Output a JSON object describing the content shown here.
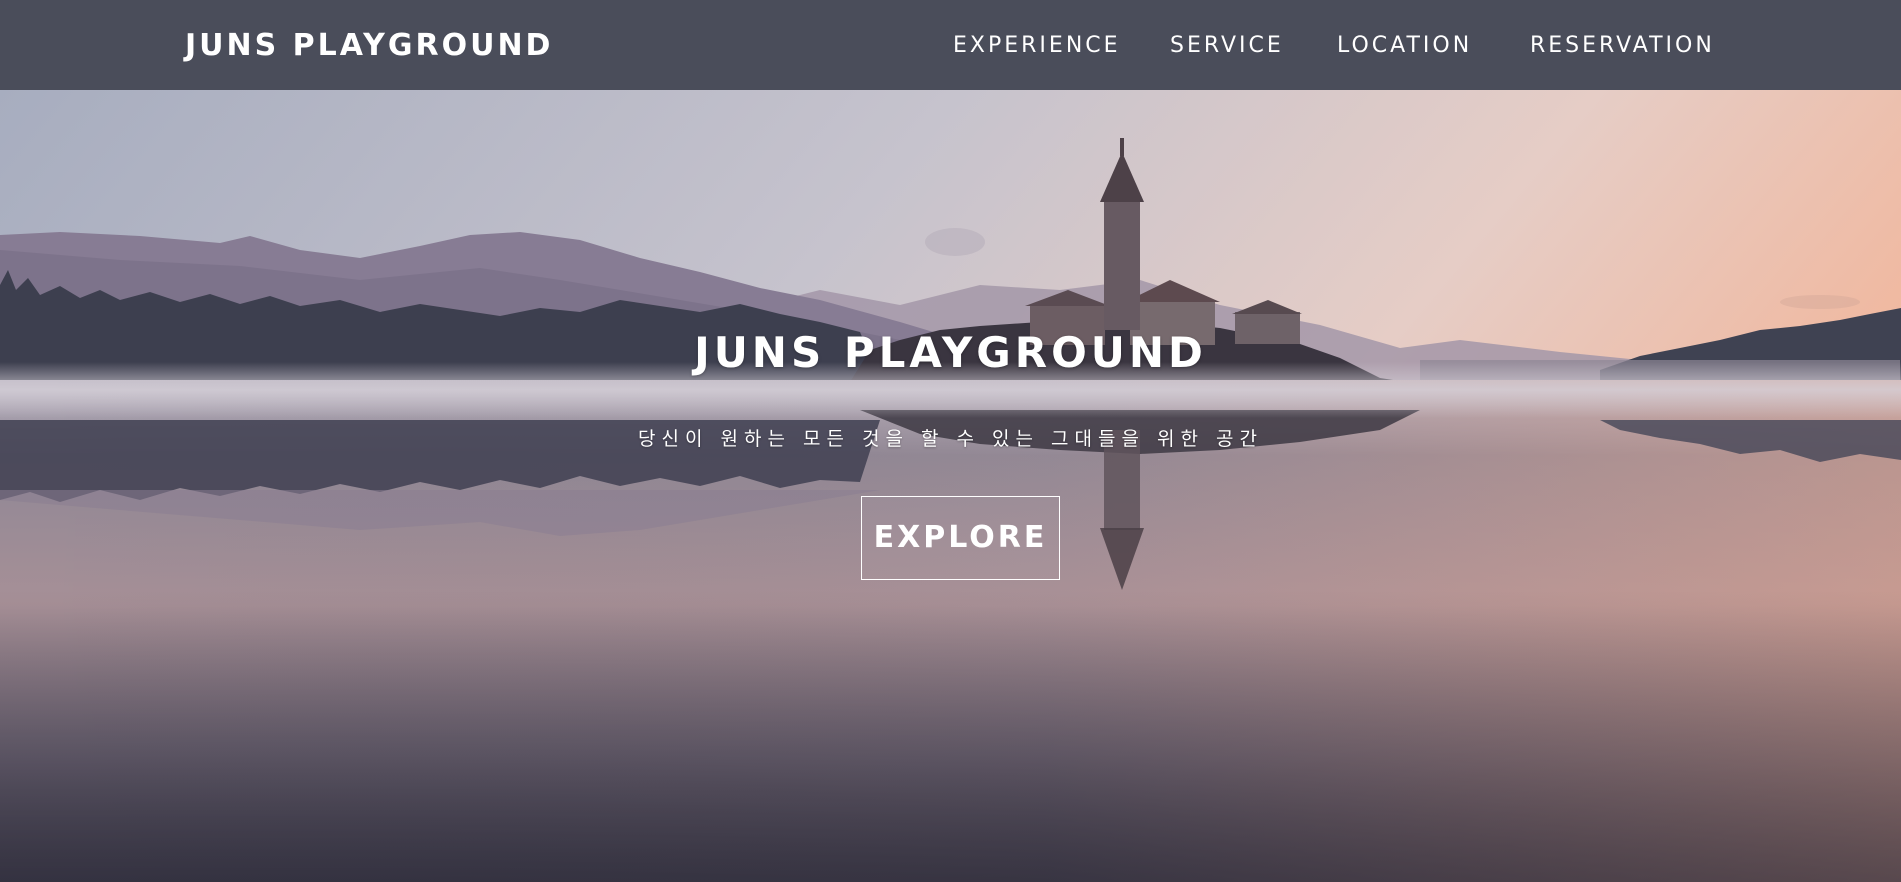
{
  "navbar": {
    "brand": "JUNS PLAYGROUND",
    "links": [
      "EXPERIENCE",
      "SERVICE",
      "LOCATION",
      "RESERVATION"
    ],
    "background": "#4a4d5a"
  },
  "hero": {
    "title": "JUNS PLAYGROUND",
    "subtitle": "당신이 원하는 모든 것을 할 수 있는 그대들을 위한 공간",
    "button_label": "EXPLORE",
    "image": "lake-island-church-sunrise"
  }
}
